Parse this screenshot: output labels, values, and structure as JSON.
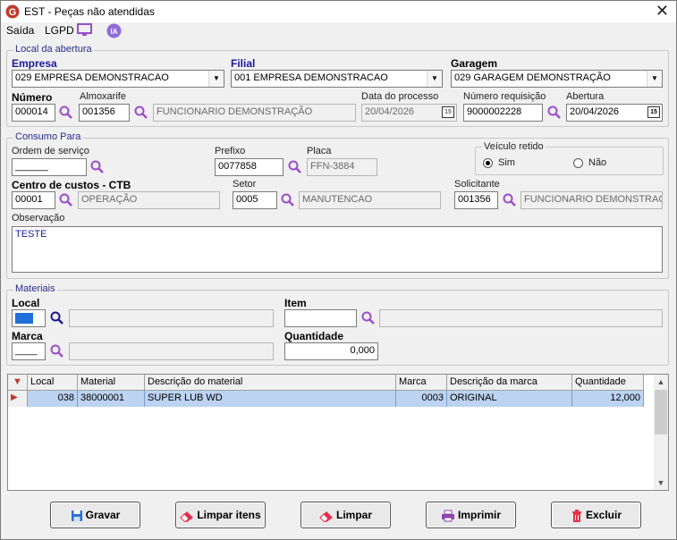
{
  "window": {
    "title": "EST - Peças não atendidas"
  },
  "menu": {
    "saida": "Saída",
    "lgpd": "LGPD",
    "ia": "IA"
  },
  "local_abertura": {
    "legend": "Local da abertura",
    "empresa_label": "Empresa",
    "empresa_value": "029 EMPRESA DEMONSTRACAO",
    "filial_label": "Filial",
    "filial_value": "001 EMPRESA DEMONSTRACAO",
    "garagem_label": "Garagem",
    "garagem_value": "029 GARAGEM DEMONSTRAÇÃO",
    "numero_label": "Número",
    "numero_value": "000014",
    "almox_label": "Almoxarife",
    "almox_code": "001356",
    "almox_name": "FUNCIONARIO DEMONSTRAÇÃO",
    "data_label": "Data do processo",
    "data_value": "20/04/2026",
    "requisicao_label": "Número requisição",
    "requisicao_value": "9000002228",
    "abertura_label": "Abertura",
    "abertura_value": "20/04/2026",
    "cal_glyph": "15"
  },
  "consumo": {
    "legend": "Consumo Para",
    "os_label": "Ordem de serviço",
    "os_value": "______",
    "prefixo_label": "Prefixo",
    "prefixo_value": "0077858",
    "placa_label": "Placa",
    "placa_value": "FFN-3884",
    "veiculo_legend": "Veículo retido",
    "sim": "Sim",
    "nao": "Não",
    "veiculo_retido": "Sim",
    "ctb_label": "Centro de custos - CTB",
    "ctb_code": "00001",
    "ctb_name": "OPERAÇÃO",
    "setor_label": "Setor",
    "setor_code": "0005",
    "setor_name": "MANUTENCAO",
    "solic_label": "Solicitante",
    "solic_code": "001356",
    "solic_name": "FUNCIONARIO DEMONSTRAÇ",
    "obs_label": "Observação",
    "obs_value": "TESTE"
  },
  "materiais": {
    "legend": "Materiais",
    "local_label": "Local",
    "item_label": "Item",
    "marca_label": "Marca",
    "marca_value": "____",
    "qtd_label": "Quantidade",
    "qtd_value": "0,000"
  },
  "grid": {
    "headers": [
      "Local",
      "Material",
      "Descrição do material",
      "Marca",
      "Descrição da marca",
      "Quantidade"
    ],
    "rows": [
      {
        "local": "038",
        "material": "38000001",
        "descricao": "SUPER LUB WD",
        "marca": "0003",
        "desc_marca": "ORIGINAL",
        "quantidade": "12,000"
      }
    ]
  },
  "buttons": {
    "gravar": "Gravar",
    "limpar_itens": "Limpar itens",
    "limpar": "Limpar",
    "imprimir": "Imprimir",
    "excluir": "Excluir"
  },
  "colors": {
    "accent": "#c0392b",
    "selection": "#bcd3f2",
    "group_legend": "#2a2a8a",
    "magnifier": "#9b4dca"
  }
}
